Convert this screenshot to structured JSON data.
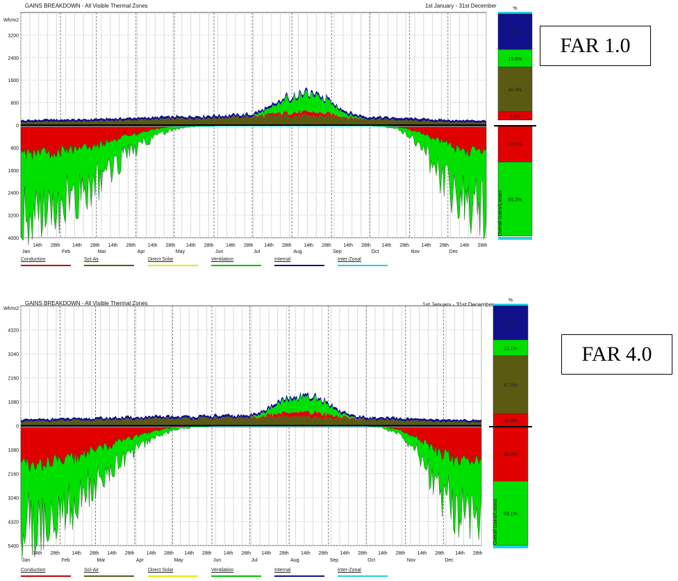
{
  "chart_data": [
    {
      "type": "area",
      "title": "GAINS BREAKDOWN - All Visible Thermal Zones",
      "date_range": "1st January - 31st December",
      "ylabel": "Wh/m2",
      "ylim": [
        -4000,
        4000
      ],
      "y_ticks": [
        "3200",
        "2400",
        "1600",
        "800",
        "0",
        "800",
        "1600",
        "2400",
        "3200",
        "4000"
      ],
      "month_labels": [
        "Jan",
        "Feb",
        "Mar",
        "Apr",
        "May",
        "Jun",
        "Jul",
        "Aug",
        "Sep",
        "Oct",
        "Nov",
        "Dec"
      ],
      "mid_labels": [
        "14th",
        "28th"
      ],
      "legend_position": "bottom",
      "series": [
        {
          "name": "Conduction",
          "color": "#e00000"
        },
        {
          "name": "Sol-Air",
          "color": "#5a5a12"
        },
        {
          "name": "Direct Solar",
          "color": "#e8e800"
        },
        {
          "name": "Ventilation",
          "color": "#00e000"
        },
        {
          "name": "Internal",
          "color": "#10108a"
        },
        {
          "name": "Inter-Zonal",
          "color": "#20d0e0"
        }
      ],
      "x": [
        0,
        15,
        30,
        45,
        60,
        75,
        90,
        105,
        120,
        135,
        150,
        165,
        180,
        195,
        210,
        225,
        240,
        255,
        270,
        285,
        300,
        315,
        330,
        345,
        364
      ],
      "gains": {
        "Sol-Air": [
          90,
          110,
          120,
          120,
          140,
          160,
          180,
          200,
          220,
          240,
          260,
          280,
          300,
          320,
          330,
          320,
          300,
          260,
          230,
          200,
          170,
          140,
          110,
          100,
          90
        ],
        "Ventilation": [
          0,
          0,
          0,
          0,
          0,
          0,
          0,
          0,
          0,
          0,
          0,
          0,
          0,
          200,
          520,
          600,
          480,
          100,
          0,
          0,
          0,
          0,
          0,
          0,
          0
        ],
        "Conduction": [
          0,
          0,
          0,
          0,
          0,
          0,
          0,
          0,
          0,
          0,
          0,
          0,
          0,
          60,
          120,
          140,
          110,
          30,
          0,
          0,
          0,
          0,
          0,
          0,
          0
        ],
        "Internal": [
          80,
          80,
          80,
          80,
          80,
          80,
          80,
          80,
          80,
          80,
          80,
          80,
          80,
          80,
          80,
          80,
          80,
          80,
          80,
          80,
          80,
          80,
          80,
          80,
          80
        ]
      },
      "losses": {
        "Conduction": [
          -1100,
          -1000,
          -950,
          -850,
          -700,
          -500,
          -300,
          -150,
          -50,
          -20,
          -10,
          0,
          0,
          0,
          0,
          0,
          0,
          0,
          0,
          -20,
          -100,
          -300,
          -600,
          -900,
          -1000
        ],
        "Ventilation": [
          -2400,
          -2200,
          -2000,
          -1700,
          -1300,
          -900,
          -500,
          -250,
          -100,
          -40,
          -20,
          0,
          0,
          0,
          0,
          0,
          0,
          0,
          0,
          -40,
          -150,
          -500,
          -1400,
          -2000,
          -2100
        ]
      },
      "percent_bar": {
        "header": "%",
        "axis_label": "Overall Gains/Losses",
        "gains": [
          {
            "series": "Internal",
            "label": "31.8%",
            "value": 31.8
          },
          {
            "series": "Ventilation",
            "label": "15.6%",
            "value": 15.6
          },
          {
            "series": "Sol-Air",
            "label": "40.0%",
            "value": 40.0
          },
          {
            "series": "Conduction",
            "label": "7.5%",
            "value": 7.5
          }
        ],
        "losses": [
          {
            "series": "Conduction",
            "label": "32.0%",
            "value": 32.0
          },
          {
            "series": "Ventilation",
            "label": "65.3%",
            "value": 65.3
          }
        ]
      },
      "annotation": "FAR 1.0"
    },
    {
      "type": "area",
      "title": "GAINS BREAKDOWN - All Visible Thermal Zones",
      "date_range": "1st January - 31st December",
      "ylabel": "Wh/m2",
      "ylim": [
        -5400,
        5400
      ],
      "y_ticks": [
        "4320",
        "3240",
        "2160",
        "1080",
        "0",
        "1080",
        "2160",
        "3240",
        "4320",
        "5400"
      ],
      "month_labels": [
        "Jan",
        "Feb",
        "Mar",
        "Apr",
        "May",
        "Jun",
        "Jul",
        "Aug",
        "Sep",
        "Oct",
        "Nov",
        "Dec"
      ],
      "mid_labels": [
        "14th",
        "28th"
      ],
      "legend_position": "bottom",
      "series": [
        {
          "name": "Conduction",
          "color": "#e00000"
        },
        {
          "name": "Sol-Air",
          "color": "#5a5a12"
        },
        {
          "name": "Direct Solar",
          "color": "#e8e800"
        },
        {
          "name": "Ventilation",
          "color": "#00e000"
        },
        {
          "name": "Internal",
          "color": "#10108a"
        },
        {
          "name": "Inter-Zonal",
          "color": "#20d0e0"
        }
      ],
      "x": [
        0,
        15,
        30,
        45,
        60,
        75,
        90,
        105,
        120,
        135,
        150,
        165,
        180,
        195,
        210,
        225,
        240,
        255,
        270,
        285,
        300,
        315,
        330,
        345,
        364
      ],
      "gains": {
        "Sol-Air": [
          170,
          200,
          220,
          230,
          250,
          270,
          290,
          310,
          320,
          330,
          340,
          350,
          360,
          380,
          390,
          380,
          360,
          320,
          290,
          260,
          230,
          200,
          180,
          170,
          160
        ],
        "Ventilation": [
          0,
          0,
          0,
          0,
          0,
          0,
          0,
          0,
          0,
          0,
          0,
          0,
          0,
          220,
          560,
          620,
          500,
          120,
          0,
          0,
          0,
          0,
          0,
          0,
          0
        ],
        "Conduction": [
          0,
          0,
          0,
          0,
          0,
          0,
          0,
          0,
          0,
          0,
          0,
          0,
          0,
          90,
          200,
          220,
          180,
          50,
          0,
          0,
          0,
          0,
          0,
          0,
          0
        ],
        "Internal": [
          100,
          100,
          100,
          100,
          100,
          100,
          100,
          100,
          100,
          100,
          100,
          100,
          100,
          100,
          100,
          100,
          100,
          100,
          100,
          100,
          100,
          100,
          100,
          100,
          100
        ]
      },
      "losses": {
        "Conduction": [
          -1800,
          -1700,
          -1600,
          -1400,
          -1100,
          -800,
          -500,
          -250,
          -80,
          -30,
          -10,
          0,
          0,
          0,
          0,
          0,
          0,
          0,
          0,
          -30,
          -200,
          -600,
          -1200,
          -1600,
          -1700
        ],
        "Ventilation": [
          -2900,
          -2700,
          -2500,
          -2100,
          -1600,
          -1100,
          -600,
          -300,
          -120,
          -50,
          -20,
          0,
          0,
          0,
          0,
          0,
          0,
          0,
          0,
          -50,
          -200,
          -700,
          -1700,
          -2300,
          -2400
        ]
      },
      "percent_bar": {
        "header": "%",
        "axis_label": "Overall Gains/Losses",
        "gains": [
          {
            "series": "Internal",
            "label": "28.2%",
            "value": 28.2
          },
          {
            "series": "Ventilation",
            "label": "13.1%",
            "value": 13.1
          },
          {
            "series": "Sol-Air",
            "label": "47.9%",
            "value": 47.9
          },
          {
            "series": "Conduction",
            "label": "10.8%",
            "value": 10.8
          }
        ],
        "losses": [
          {
            "series": "Conduction",
            "label": "45.0%",
            "value": 45.0
          },
          {
            "series": "Ventilation",
            "label": "53.1%",
            "value": 53.1
          }
        ]
      },
      "annotation": "FAR 4.0"
    }
  ]
}
